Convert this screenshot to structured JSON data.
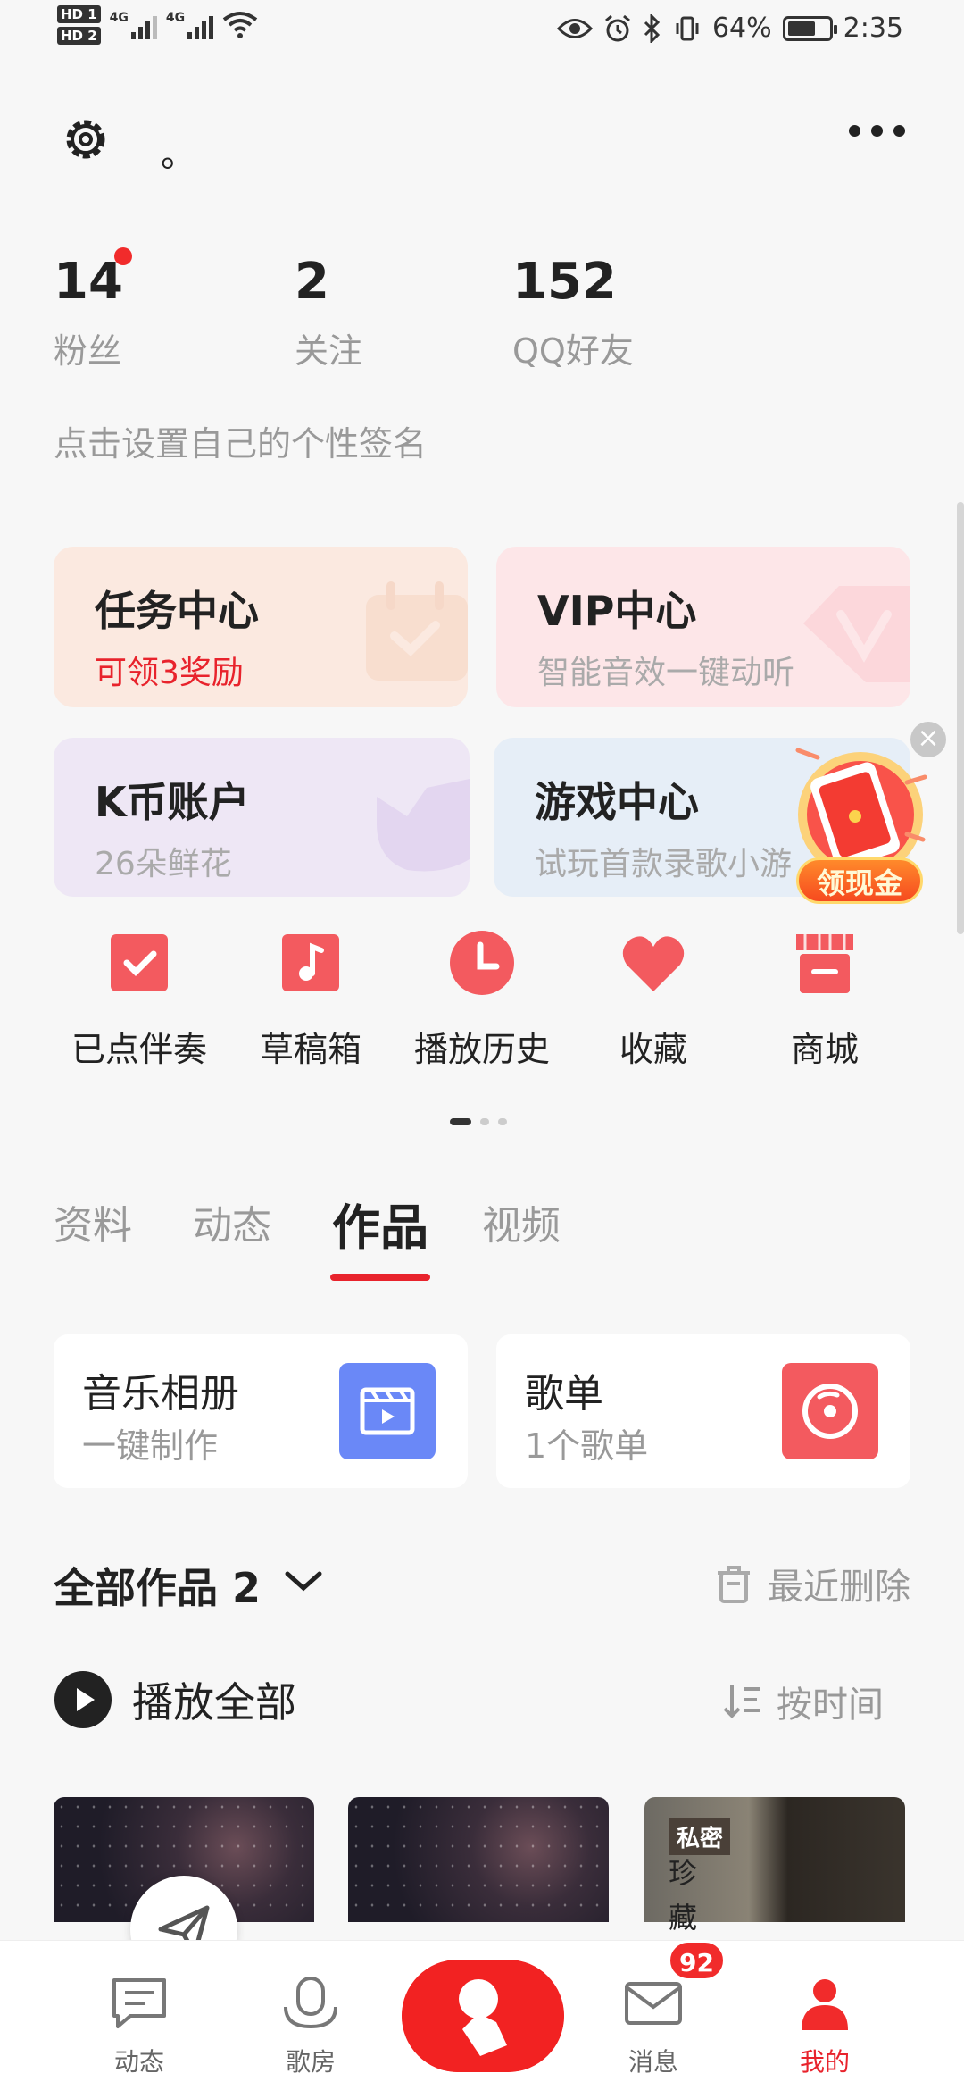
{
  "status_bar": {
    "hd1": "HD 1",
    "hd2": "HD 2",
    "net1": "4G",
    "net2": "4G",
    "battery_percent": "64%",
    "time": "2:35"
  },
  "header": {
    "settings_icon": "gear-icon",
    "nickname": "。",
    "more_icon": "more-dots-icon"
  },
  "stats": [
    {
      "value": "14",
      "label": "粉丝"
    },
    {
      "value": "2",
      "label": "关注"
    },
    {
      "value": "152",
      "label": "QQ好友"
    }
  ],
  "signature": "点击设置自己的个性签名",
  "cards": {
    "task": {
      "title": "任务中心",
      "subtitle": "可领3奖励"
    },
    "vip": {
      "title": "VIP中心",
      "subtitle": "智能音效一键动听"
    },
    "kcoin": {
      "title": "K币账户",
      "subtitle": "26朵鲜花"
    },
    "game": {
      "title": "游戏中心",
      "subtitle": "试玩首款录歌小游"
    }
  },
  "promo": {
    "label": "领现金"
  },
  "shortcuts": [
    {
      "label": "已点伴奏",
      "icon": "check-icon"
    },
    {
      "label": "草稿箱",
      "icon": "music-note-icon"
    },
    {
      "label": "播放历史",
      "icon": "clock-icon"
    },
    {
      "label": "收藏",
      "icon": "heart-icon"
    },
    {
      "label": "商城",
      "icon": "store-icon"
    }
  ],
  "tabs": [
    "资料",
    "动态",
    "作品",
    "视频"
  ],
  "active_tab": "作品",
  "work_cards": [
    {
      "title": "音乐相册",
      "subtitle": "一键制作"
    },
    {
      "title": "歌单",
      "subtitle": "1个歌单"
    }
  ],
  "works": {
    "all_label": "全部作品 2",
    "recent_delete": "最近删除",
    "play_all": "播放全部",
    "sort_label": "按时间"
  },
  "thumbs": {
    "private_tag": "私密",
    "vertical_text": "珍藏"
  },
  "bottom_nav": [
    {
      "label": "动态",
      "icon": "feed-icon"
    },
    {
      "label": "歌房",
      "icon": "mic-icon"
    },
    {
      "label": "",
      "icon": "sing-icon"
    },
    {
      "label": "消息",
      "icon": "mail-icon"
    },
    {
      "label": "我的",
      "icon": "user-icon"
    }
  ],
  "message_badge": "92",
  "colors": {
    "accent": "#e8232c",
    "task_bg": "#fbe9e0",
    "vip_bg": "#fde6e8",
    "kcoin_bg": "#eee7f5",
    "game_bg": "#e6eef7",
    "album_icon": "#6a88f7",
    "playlist_icon": "#f35a5f"
  }
}
